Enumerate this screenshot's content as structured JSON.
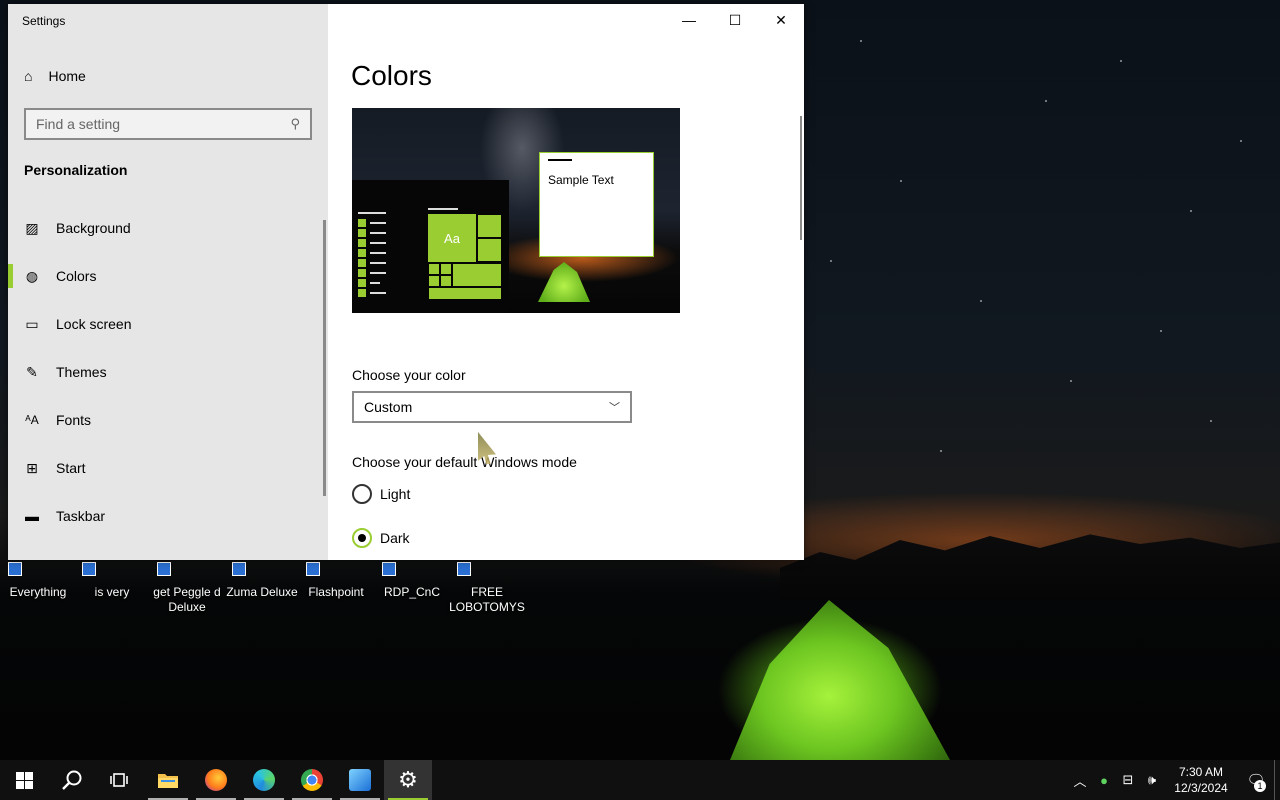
{
  "window": {
    "title": "Settings",
    "controls": {
      "minimize": "—",
      "maximize": "☐",
      "close": "✕"
    }
  },
  "sidebar": {
    "home_label": "Home",
    "search_placeholder": "Find a setting",
    "section_title": "Personalization",
    "items": [
      {
        "label": "Background",
        "icon": "picture-icon"
      },
      {
        "label": "Colors",
        "icon": "palette-icon",
        "active": true
      },
      {
        "label": "Lock screen",
        "icon": "lock-screen-icon"
      },
      {
        "label": "Themes",
        "icon": "brush-icon"
      },
      {
        "label": "Fonts",
        "icon": "font-icon"
      },
      {
        "label": "Start",
        "icon": "start-icon"
      },
      {
        "label": "Taskbar",
        "icon": "taskbar-icon"
      }
    ]
  },
  "main": {
    "page_title": "Colors",
    "preview": {
      "sample_text": "Sample Text",
      "tile_text": "Aa"
    },
    "choose_color_label": "Choose your color",
    "choose_color_value": "Custom",
    "mode_label": "Choose your default Windows mode",
    "modes": [
      {
        "label": "Light",
        "checked": false
      },
      {
        "label": "Dark",
        "checked": true
      }
    ]
  },
  "accent_color": "#9acd32",
  "desktop_icons": [
    {
      "label": "Everything"
    },
    {
      "label": "is very"
    },
    {
      "label": "get Peggle d Deluxe"
    },
    {
      "label": "Zuma Deluxe"
    },
    {
      "label": "Flashpoint"
    },
    {
      "label": "RDP_CnC"
    },
    {
      "label": "FREE LOBOTOMYS"
    }
  ],
  "taskbar": {
    "apps": [
      {
        "name": "start-button",
        "icon": "windows-icon"
      },
      {
        "name": "search-button",
        "icon": "search-icon"
      },
      {
        "name": "task-view-button",
        "icon": "task-view-icon"
      },
      {
        "name": "file-explorer-button",
        "icon": "folder-icon",
        "running": true
      },
      {
        "name": "firefox-button",
        "icon": "firefox-icon",
        "running": true
      },
      {
        "name": "edge-button",
        "icon": "edge-icon",
        "running": true
      },
      {
        "name": "chrome-button",
        "icon": "chrome-icon",
        "running": true
      },
      {
        "name": "photos-button",
        "icon": "photos-icon",
        "running": true
      },
      {
        "name": "settings-button",
        "icon": "gear-icon",
        "running": true,
        "active": true
      }
    ],
    "clock": {
      "time": "7:30 AM",
      "date": "12/3/2024"
    },
    "notification_count": "1"
  }
}
